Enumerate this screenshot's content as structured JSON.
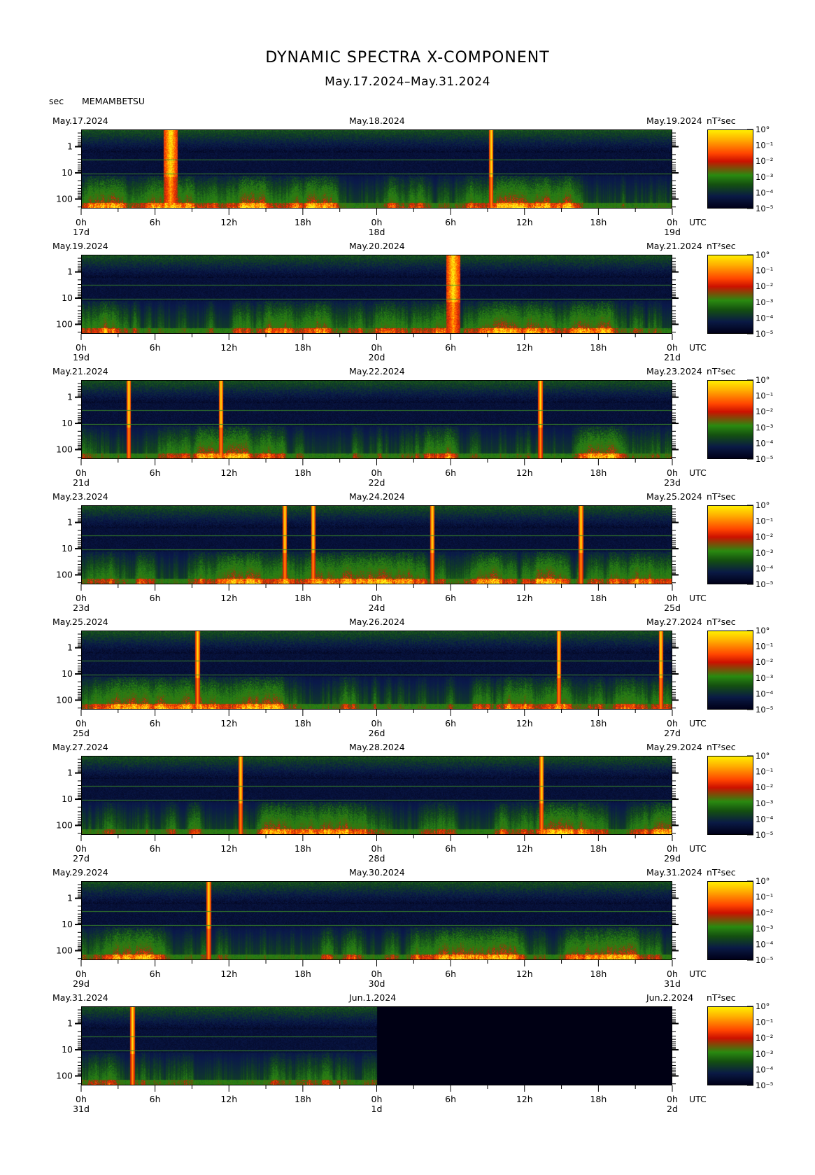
{
  "title": "DYNAMIC SPECTRA X-COMPONENT",
  "subtitle": "May.17.2024–May.31.2024",
  "unit_label": "sec",
  "station": "MEMAMBETSU",
  "colorbar_unit": "nT²sec",
  "colorbar_ticks": [
    "10°",
    "10⁻¹",
    "10⁻²",
    "10⁻³",
    "10⁻⁴",
    "10⁻⁵"
  ],
  "utc_label": "UTC",
  "chart_data": {
    "type": "heatmap",
    "y_axis": {
      "label": "sec",
      "scale": "log",
      "ticks": [
        "1",
        "10",
        "100"
      ]
    },
    "x_ticks": [
      "0h",
      "6h",
      "12h",
      "18h",
      "0h",
      "6h",
      "12h",
      "18h",
      "0h"
    ],
    "panels": [
      {
        "left_date": "May.17.2024",
        "mid_date": "May.18.2024",
        "right_date": "May.19.2024",
        "day_labels": [
          "17d",
          "18d",
          "19d"
        ],
        "bursts_hours": [
          7.2,
          33.3
        ],
        "wide_bursts_hours": [
          7.2
        ]
      },
      {
        "left_date": "May.19.2024",
        "mid_date": "May.20.2024",
        "right_date": "May.21.2024",
        "day_labels": [
          "19d",
          "20d",
          "21d"
        ],
        "bursts_hours": [
          30.2
        ],
        "wide_bursts_hours": [
          30.2
        ]
      },
      {
        "left_date": "May.21.2024",
        "mid_date": "May.22.2024",
        "right_date": "May.23.2024",
        "day_labels": [
          "21d",
          "22d",
          "23d"
        ],
        "bursts_hours": [
          3.8,
          11.3,
          37.3
        ],
        "wide_bursts_hours": []
      },
      {
        "left_date": "May.23.2024",
        "mid_date": "May.24.2024",
        "right_date": "May.25.2024",
        "day_labels": [
          "23d",
          "24d",
          "25d"
        ],
        "bursts_hours": [
          16.5,
          18.8,
          28.5,
          40.6
        ],
        "wide_bursts_hours": []
      },
      {
        "left_date": "May.25.2024",
        "mid_date": "May.26.2024",
        "right_date": "May.27.2024",
        "day_labels": [
          "25d",
          "26d",
          "27d"
        ],
        "bursts_hours": [
          9.4,
          38.8,
          47.1
        ],
        "wide_bursts_hours": []
      },
      {
        "left_date": "May.27.2024",
        "mid_date": "May.28.2024",
        "right_date": "May.29.2024",
        "day_labels": [
          "27d",
          "28d",
          "29d"
        ],
        "bursts_hours": [
          12.9,
          37.4
        ],
        "wide_bursts_hours": []
      },
      {
        "left_date": "May.29.2024",
        "mid_date": "May.30.2024",
        "right_date": "May.31.2024",
        "day_labels": [
          "29d",
          "30d",
          "31d"
        ],
        "bursts_hours": [
          10.3
        ],
        "wide_bursts_hours": []
      },
      {
        "left_date": "May.31.2024",
        "mid_date": "Jun.1.2024",
        "right_date": "Jun.2.2024",
        "day_labels": [
          "31d",
          "1d",
          "2d"
        ],
        "bursts_hours": [
          4.1
        ],
        "wide_bursts_hours": [],
        "data_end_hours": 24
      }
    ]
  }
}
